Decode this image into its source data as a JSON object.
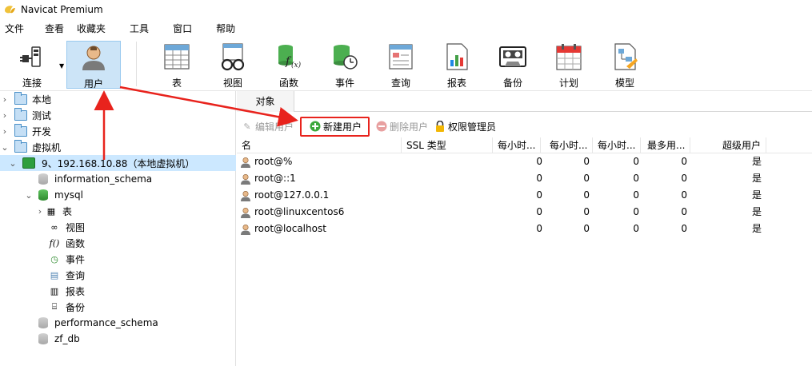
{
  "app": {
    "title": "Navicat Premium"
  },
  "menu": [
    "文件",
    "查看",
    "收藏夹",
    "工具",
    "窗口",
    "帮助"
  ],
  "toolbar": {
    "connect": "连接",
    "user": "用户",
    "table": "表",
    "view": "视图",
    "function": "函数",
    "event": "事件",
    "query": "查询",
    "report": "报表",
    "backup": "备份",
    "schedule": "计划",
    "model": "模型"
  },
  "tree": {
    "local": "本地",
    "test": "测试",
    "dev": "开发",
    "vm": "虚拟机",
    "connection": "9、192.168.10.88（本地虚拟机）",
    "db_information_schema": "information_schema",
    "db_mysql": "mysql",
    "mysql_table": "表",
    "mysql_view": "视图",
    "mysql_function": "函数",
    "mysql_event": "事件",
    "mysql_query": "查询",
    "mysql_report": "报表",
    "mysql_backup": "备份",
    "db_performance_schema": "performance_schema",
    "db_zf_db": "zf_db"
  },
  "tabs": {
    "objects": "对象"
  },
  "actions": {
    "edit_user": "编辑用户",
    "new_user": "新建用户",
    "delete_user": "删除用户",
    "privilege_manager": "权限管理员"
  },
  "grid": {
    "columns": [
      "名",
      "SSL 类型",
      "每小时...",
      "每小时...",
      "每小时...",
      "最多用...",
      "超级用户"
    ],
    "rows": [
      {
        "name": "root@%",
        "c1": "0",
        "c2": "0",
        "c3": "0",
        "c4": "0",
        "super": "是"
      },
      {
        "name": "root@::1",
        "c1": "0",
        "c2": "0",
        "c3": "0",
        "c4": "0",
        "super": "是"
      },
      {
        "name": "root@127.0.0.1",
        "c1": "0",
        "c2": "0",
        "c3": "0",
        "c4": "0",
        "super": "是"
      },
      {
        "name": "root@linuxcentos6",
        "c1": "0",
        "c2": "0",
        "c3": "0",
        "c4": "0",
        "super": "是"
      },
      {
        "name": "root@localhost",
        "c1": "0",
        "c2": "0",
        "c3": "0",
        "c4": "0",
        "super": "是"
      }
    ]
  },
  "colors": {
    "annotation_red": "#e8231d",
    "selection": "#cce8ff",
    "active_tool": "#cce4f7"
  }
}
